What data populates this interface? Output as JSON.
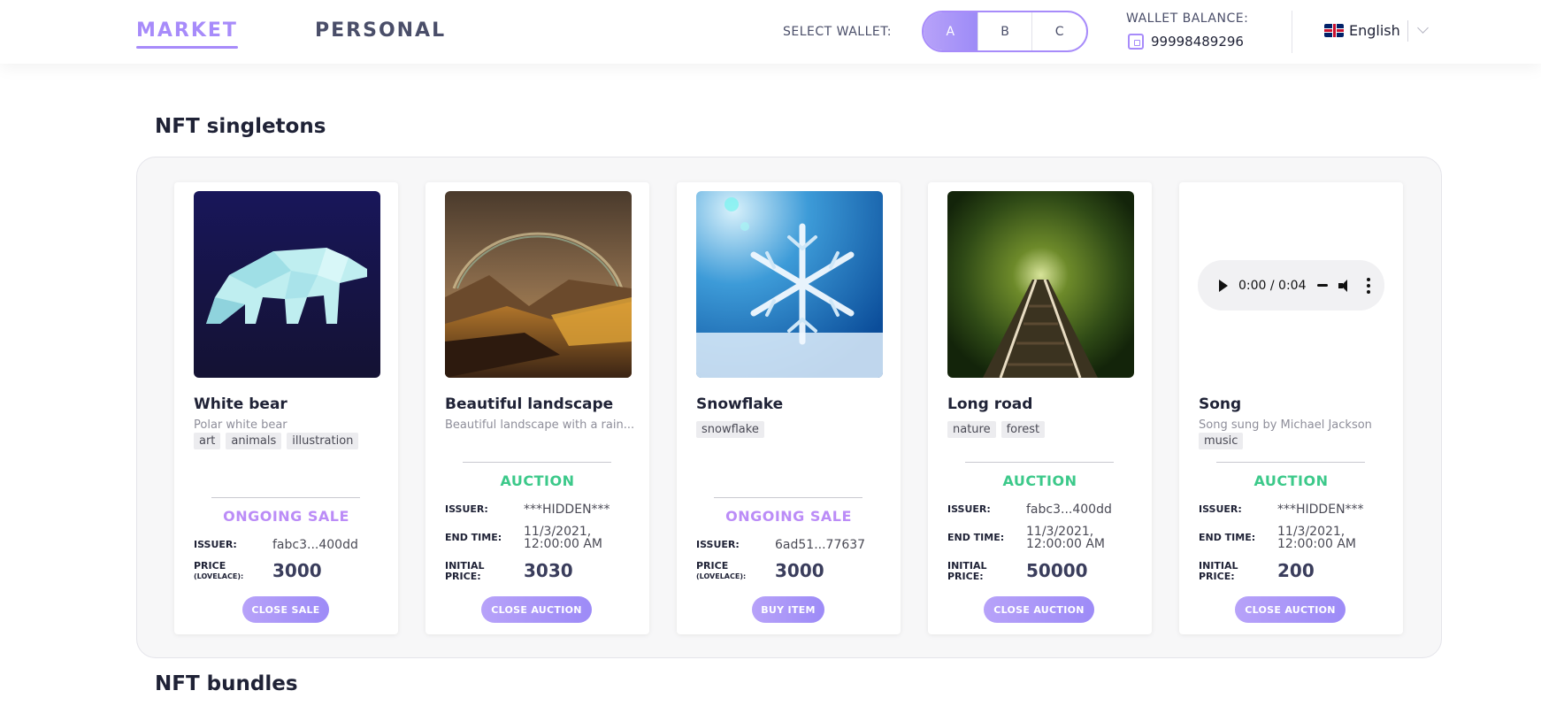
{
  "nav": {
    "market_label": "MARKET",
    "personal_label": "PERSONAL"
  },
  "wallet": {
    "select_label": "SELECT WALLET:",
    "options": [
      "A",
      "B",
      "C"
    ],
    "selected": "A",
    "balance_label": "WALLET BALANCE:",
    "balance_value": "99998489296"
  },
  "language": {
    "label": "English",
    "icon": "uk-flag-icon"
  },
  "sections": {
    "singletons_title": "NFT singletons",
    "bundles_title": "NFT bundles"
  },
  "colors": {
    "accent": "#a78bfa",
    "sale_status": "#bb8cf7",
    "auction_status": "#3cc98a"
  },
  "cards": [
    {
      "title": "White bear",
      "description": "Polar white bear",
      "tags": [
        "art",
        "animals",
        "illustration"
      ],
      "status": "ONGOING SALE",
      "labels": {
        "issuer": "ISSUER:",
        "price": "PRICE",
        "price_unit": "(LOVELACE):"
      },
      "issuer": "fabc3...400dd",
      "price": "3000",
      "button": "CLOSE SALE",
      "media": "polar-bear-image"
    },
    {
      "title": "Beautiful landscape",
      "description": "Beautiful landscape with a rain...",
      "tags": [],
      "status": "AUCTION",
      "labels": {
        "issuer": "ISSUER:",
        "end_time": "END TIME:",
        "initial_price_1": "INITIAL",
        "initial_price_2": "PRICE:"
      },
      "issuer": "***HIDDEN***",
      "end_time_1": "11/3/2021,",
      "end_time_2": "12:00:00 AM",
      "price": "3030",
      "button": "CLOSE AUCTION",
      "media": "landscape-rainbow-image"
    },
    {
      "title": "Snowflake",
      "description": "",
      "tags": [
        "snowflake"
      ],
      "status": "ONGOING SALE",
      "labels": {
        "issuer": "ISSUER:",
        "price": "PRICE",
        "price_unit": "(LOVELACE):"
      },
      "issuer": "6ad51...77637",
      "price": "3000",
      "button": "BUY ITEM",
      "media": "snowflake-image"
    },
    {
      "title": "Long road",
      "description": "",
      "tags": [
        "nature",
        "forest"
      ],
      "status": "AUCTION",
      "labels": {
        "issuer": "ISSUER:",
        "end_time": "END TIME:",
        "initial_price_1": "INITIAL",
        "initial_price_2": "PRICE:"
      },
      "issuer": "fabc3...400dd",
      "end_time_1": "11/3/2021,",
      "end_time_2": "12:00:00 AM",
      "price": "50000",
      "button": "CLOSE AUCTION",
      "media": "forest-railway-image"
    },
    {
      "title": "Song",
      "description": "Song sung by Michael Jackson",
      "tags": [
        "music"
      ],
      "status": "AUCTION",
      "labels": {
        "issuer": "ISSUER:",
        "end_time": "END TIME:",
        "initial_price_1": "INITIAL",
        "initial_price_2": "PRICE:"
      },
      "issuer": "***HIDDEN***",
      "end_time_1": "11/3/2021,",
      "end_time_2": "12:00:00 AM",
      "price": "200",
      "button": "CLOSE AUCTION",
      "media": "audio-player",
      "audio_time": "0:00 / 0:04"
    }
  ]
}
